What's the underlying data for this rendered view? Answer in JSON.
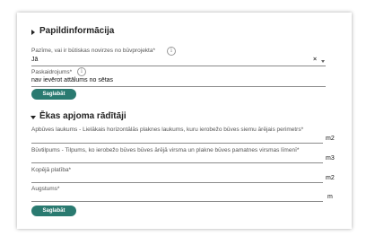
{
  "sections": {
    "additional": {
      "title": "Papildinformācija",
      "fields": {
        "mark_question": {
          "label": "Pazīme, vai ir būtiskas novirzes no būvprojekta*",
          "info_icon": "i",
          "value": "Jā",
          "clear": "×"
        },
        "explanation": {
          "label": "Paskaidrojums*",
          "info_icon": "i",
          "value": "nav ievērot attālums no sētas"
        }
      },
      "save_label": "Saglabāt"
    },
    "building": {
      "title": "Ēkas apjoma rādītāji",
      "fields": {
        "built_area": {
          "label": "Apbūves laukums - Lielākais horizontālās plaknes laukums, kuru ierobežo būves siemu ārējais perimetrs*",
          "unit": "m2"
        },
        "volume": {
          "label": "Būvtilpums - Tilpums, ko ierobežo būves būves ārējā virsma un plakne būves pamatnes virsmas līmenī*",
          "unit": "m3"
        },
        "total_area": {
          "label": "Kopējā platība*",
          "unit": "m2"
        },
        "height": {
          "label": "Augstums*",
          "unit": "m"
        }
      },
      "save_label": "Saglabāt"
    }
  },
  "colors": {
    "button": "#2a7a70",
    "underline": "#8a8a8a"
  },
  "icons": {
    "collapse": "triangle-right-icon",
    "expand": "triangle-down-icon",
    "info": "info-icon",
    "dropdown": "chevron-down-icon"
  }
}
